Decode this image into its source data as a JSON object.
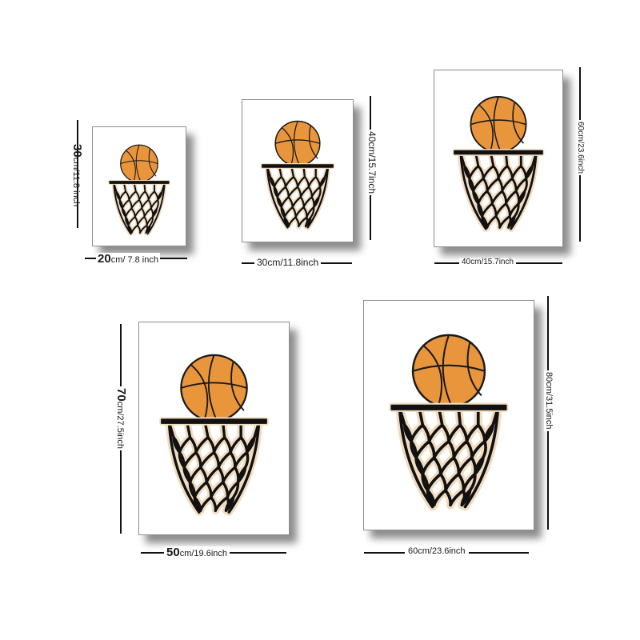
{
  "colors": {
    "ball": "#E8953C",
    "ball_lines": "#1a1a1a",
    "net": "#111111",
    "net_halo": "#F1DCC0",
    "frame_border": "#8f8f8f"
  },
  "posters": [
    {
      "width_label_main": "20",
      "width_label_unit": "cm/ 7.8 inch",
      "height_label_main": "30",
      "height_label_unit": "cm/11.8 inch"
    },
    {
      "width_label": "30cm/11.8inch",
      "height_label": "40cm/15.7inch"
    },
    {
      "width_label": "40cm/15.7inch",
      "height_label": "60cm/23.6inch"
    },
    {
      "width_label_main": "50",
      "width_label_unit": "cm/19.6inch",
      "height_label_main": "70",
      "height_label_unit": "cm/27.5inch"
    },
    {
      "width_label": "60cm/23.6inch",
      "height_label": "80cm/31.5inch"
    }
  ],
  "artwork": {
    "subject": "basketball-in-hoop-illustration"
  }
}
